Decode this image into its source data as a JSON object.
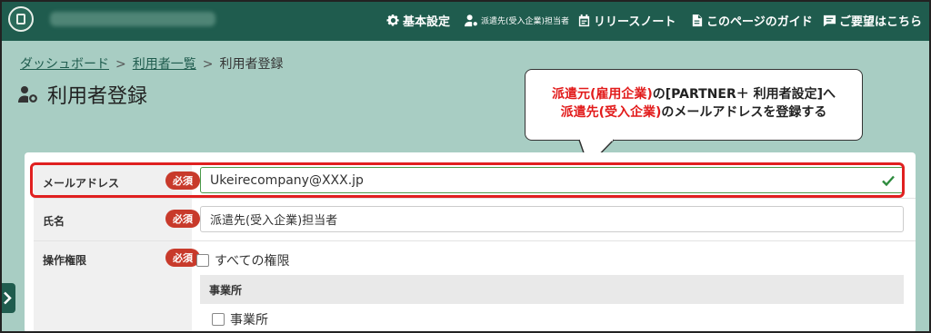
{
  "header": {
    "nav": [
      {
        "label": "基本設定",
        "icon": "gear-icon"
      },
      {
        "label": "派遣先(受入企業)担当者",
        "icon": "user-gear-icon"
      },
      {
        "label": "リリースノート",
        "icon": "calendar-icon"
      },
      {
        "label": "このページのガイド",
        "icon": "document-icon"
      },
      {
        "label": "ご要望はこちら",
        "icon": "message-icon"
      }
    ]
  },
  "breadcrumb": {
    "items": [
      "ダッシュボード",
      "利用者一覧",
      "利用者登録"
    ],
    "separator": ">"
  },
  "page": {
    "title": "利用者登録"
  },
  "callout": {
    "line1_red": "派遣元(雇用企業)",
    "line1_rest": "の[PARTNER＋ 利用者設定]へ",
    "line2_red": "派遣先(受入企業)",
    "line2_rest": "のメールアドレスを登録する"
  },
  "form": {
    "required_label": "必須",
    "email": {
      "label": "メールアドレス",
      "value": "Ukeirecompany@XXX.jp"
    },
    "name": {
      "label": "氏名",
      "value": "派遣先(受入企業)担当者"
    },
    "permissions": {
      "label": "操作権限",
      "all_label": "すべての権限",
      "section_header": "事業所",
      "item_label": "事業所"
    }
  },
  "colors": {
    "header": "#1f5c4e",
    "background": "#a8cdc3",
    "required": "#c83a2b",
    "highlight": "#e02020",
    "valid": "#2e8b3e"
  }
}
